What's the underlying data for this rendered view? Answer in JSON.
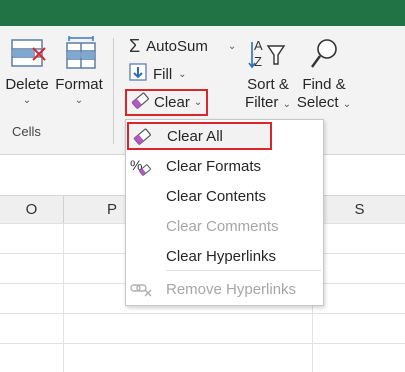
{
  "ribbon": {
    "cells_group": {
      "label": "Cells",
      "delete_label": "Delete",
      "format_label": "Format"
    },
    "editing_group": {
      "autosum_label": "AutoSum",
      "fill_label": "Fill",
      "clear_label": "Clear",
      "sort_filter_line1": "Sort &",
      "sort_filter_line2": "Filter",
      "find_select_line1": "Find &",
      "find_select_line2": "Select"
    }
  },
  "columns": [
    "O",
    "P",
    "S"
  ],
  "clear_menu": {
    "items": [
      {
        "label": "Clear All",
        "icon": "eraser-icon",
        "state": "highlighted"
      },
      {
        "label": "Clear Formats",
        "icon": "percent-eraser-icon",
        "state": "enabled"
      },
      {
        "label": "Clear Contents",
        "icon": "",
        "state": "enabled"
      },
      {
        "label": "Clear Comments",
        "icon": "",
        "state": "disabled"
      },
      {
        "label": "Clear Hyperlinks",
        "icon": "",
        "state": "enabled"
      },
      {
        "label": "Remove Hyperlinks",
        "icon": "link-remove-icon",
        "state": "disabled"
      }
    ]
  },
  "colors": {
    "title_bar": "#217346",
    "highlight_border": "#d9262b",
    "eraser_accent": "#b455c8"
  }
}
